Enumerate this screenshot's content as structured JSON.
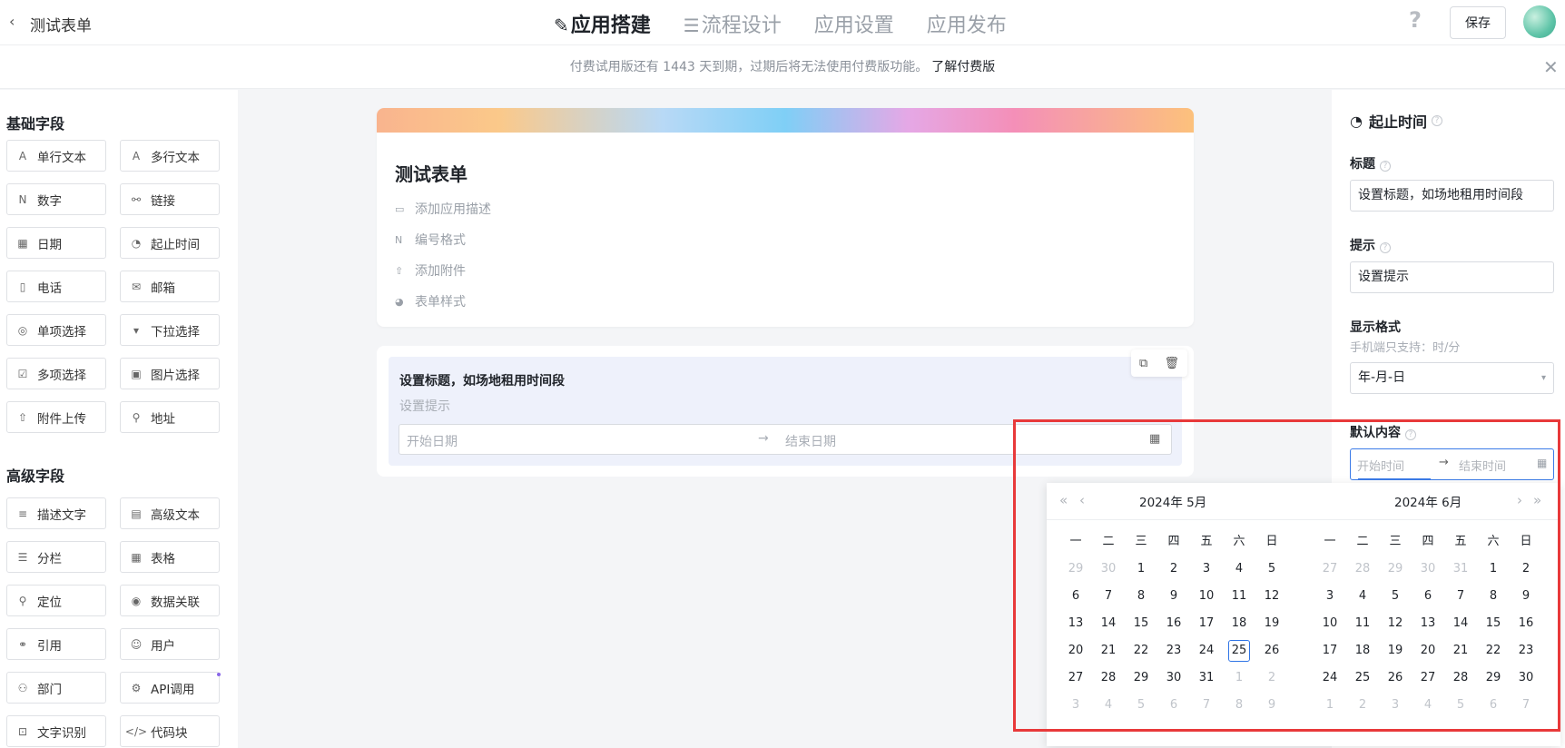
{
  "header": {
    "back_icon": "chevron-left-icon",
    "back_glyph": "‹",
    "app_title": "测试表单",
    "tabs": [
      {
        "label": "应用搭建",
        "icon": "edit-icon",
        "glyph": "✎"
      },
      {
        "label": "流程设计",
        "icon": "flow-icon",
        "glyph": "☰"
      },
      {
        "label": "应用设置"
      },
      {
        "label": "应用发布"
      }
    ],
    "help_glyph": "?",
    "save_label": "保存",
    "accent": "#2160d8"
  },
  "notice": {
    "text": "付费试用版还有 1443 天到期，过期后将无法使用付费版功能。",
    "link": "了解付费版",
    "close_glyph": "✕"
  },
  "left_panel": {
    "basic_title": "基础字段",
    "advanced_title": "高级字段",
    "basic": [
      {
        "label": "单行文本",
        "icon": "text-icon",
        "glyph": "A"
      },
      {
        "label": "多行文本",
        "icon": "multiline-text-icon",
        "glyph": "A"
      },
      {
        "label": "数字",
        "icon": "number-icon",
        "glyph": "N"
      },
      {
        "label": "链接",
        "icon": "link-icon",
        "glyph": "⚯"
      },
      {
        "label": "日期",
        "icon": "calendar-icon",
        "glyph": "▦"
      },
      {
        "label": "起止时间",
        "icon": "clock-icon",
        "glyph": "◔"
      },
      {
        "label": "电话",
        "icon": "phone-icon",
        "glyph": "▯"
      },
      {
        "label": "邮箱",
        "icon": "mail-icon",
        "glyph": "✉"
      },
      {
        "label": "单项选择",
        "icon": "radio-icon",
        "glyph": "◎"
      },
      {
        "label": "下拉选择",
        "icon": "dropdown-icon",
        "glyph": "▾"
      },
      {
        "label": "多项选择",
        "icon": "checkbox-icon",
        "glyph": "☑"
      },
      {
        "label": "图片选择",
        "icon": "image-icon",
        "glyph": "▣"
      },
      {
        "label": "附件上传",
        "icon": "upload-icon",
        "glyph": "⇧"
      },
      {
        "label": "地址",
        "icon": "location-icon",
        "glyph": "⚲"
      }
    ],
    "advanced": [
      {
        "label": "描述文字",
        "icon": "description-icon",
        "glyph": "≡"
      },
      {
        "label": "高级文本",
        "icon": "rich-text-icon",
        "glyph": "▤"
      },
      {
        "label": "分栏",
        "icon": "columns-icon",
        "glyph": "☰"
      },
      {
        "label": "表格",
        "icon": "table-icon",
        "glyph": "▦"
      },
      {
        "label": "定位",
        "icon": "pin-icon",
        "glyph": "⚲"
      },
      {
        "label": "数据关联",
        "icon": "data-link-icon",
        "glyph": "◉"
      },
      {
        "label": "引用",
        "icon": "reference-icon",
        "glyph": "⚭"
      },
      {
        "label": "用户",
        "icon": "user-icon",
        "glyph": "☺"
      },
      {
        "label": "部门",
        "icon": "department-icon",
        "glyph": "⚇"
      },
      {
        "label": "API调用",
        "icon": "api-icon",
        "glyph": "⚙"
      },
      {
        "label": "文字识别",
        "icon": "ocr-icon",
        "glyph": "⊡"
      },
      {
        "label": "代码块",
        "icon": "code-icon",
        "glyph": "</>"
      }
    ]
  },
  "form": {
    "title": "测试表单",
    "options": [
      {
        "label": "添加应用描述",
        "icon": "comment-icon",
        "glyph": "▭"
      },
      {
        "label": "编号格式",
        "icon": "number-icon",
        "glyph": "N"
      },
      {
        "label": "添加附件",
        "icon": "upload-icon",
        "glyph": "⇧"
      },
      {
        "label": "表单样式",
        "icon": "palette-icon",
        "glyph": "◕"
      }
    ],
    "field": {
      "title": "设置标题，如场地租用时间段",
      "hint": "设置提示",
      "start_placeholder": "开始日期",
      "end_placeholder": "结束日期",
      "arrow": "→",
      "copy_glyph": "⧉",
      "delete_glyph": "🗑",
      "cal_glyph": "▦"
    }
  },
  "right_panel": {
    "title": "起止时间",
    "title_icon": "clock-icon",
    "title_glyph": "◔",
    "help_glyph": "?",
    "label_title": "标题",
    "title_value": "设置标题，如场地租用时间段",
    "label_hint": "提示",
    "hint_value": "设置提示",
    "label_format": "显示格式",
    "format_sub": "手机端只支持：时/分",
    "format_value": "年-月-日",
    "format_caret": "▾",
    "label_default": "默认内容",
    "start_placeholder": "开始时间",
    "end_placeholder": "结束时间",
    "arrow": "→",
    "cal_glyph": "▦"
  },
  "calendar": {
    "nav_prev_year": "«",
    "nav_prev_month": "‹",
    "nav_next_month": "›",
    "nav_next_year": "»",
    "left_header": "2024年  5月",
    "right_header": "2024年  6月",
    "weekdays": [
      "一",
      "二",
      "三",
      "四",
      "五",
      "六",
      "日"
    ],
    "left_days": [
      [
        "29",
        "30",
        "1",
        "2",
        "3",
        "4",
        "5"
      ],
      [
        "6",
        "7",
        "8",
        "9",
        "10",
        "11",
        "12"
      ],
      [
        "13",
        "14",
        "15",
        "16",
        "17",
        "18",
        "19"
      ],
      [
        "20",
        "21",
        "22",
        "23",
        "24",
        "25",
        "26"
      ],
      [
        "27",
        "28",
        "29",
        "30",
        "31",
        "1",
        "2"
      ],
      [
        "3",
        "4",
        "5",
        "6",
        "7",
        "8",
        "9"
      ]
    ],
    "left_muted": [
      [
        0,
        0
      ],
      [
        0,
        1
      ],
      [
        4,
        5
      ],
      [
        4,
        6
      ],
      [
        5,
        0
      ],
      [
        5,
        1
      ],
      [
        5,
        2
      ],
      [
        5,
        3
      ],
      [
        5,
        4
      ],
      [
        5,
        5
      ],
      [
        5,
        6
      ]
    ],
    "left_today": [
      3,
      5
    ],
    "right_days": [
      [
        "27",
        "28",
        "29",
        "30",
        "31",
        "1",
        "2"
      ],
      [
        "3",
        "4",
        "5",
        "6",
        "7",
        "8",
        "9"
      ],
      [
        "10",
        "11",
        "12",
        "13",
        "14",
        "15",
        "16"
      ],
      [
        "17",
        "18",
        "19",
        "20",
        "21",
        "22",
        "23"
      ],
      [
        "24",
        "25",
        "26",
        "27",
        "28",
        "29",
        "30"
      ],
      [
        "1",
        "2",
        "3",
        "4",
        "5",
        "6",
        "7"
      ]
    ],
    "right_muted": [
      [
        0,
        0
      ],
      [
        0,
        1
      ],
      [
        0,
        2
      ],
      [
        0,
        3
      ],
      [
        0,
        4
      ],
      [
        5,
        0
      ],
      [
        5,
        1
      ],
      [
        5,
        2
      ],
      [
        5,
        3
      ],
      [
        5,
        4
      ],
      [
        5,
        5
      ],
      [
        5,
        6
      ]
    ]
  }
}
